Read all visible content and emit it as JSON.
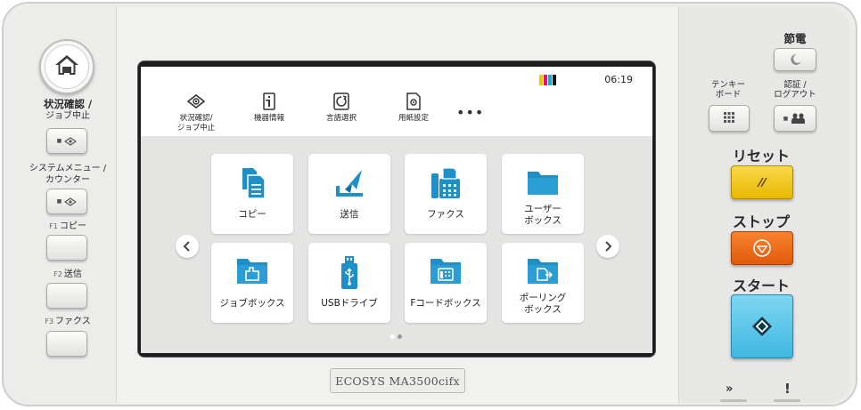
{
  "left_panel": {
    "home": {
      "icon": "home-icon"
    },
    "status_label": [
      "状況確認 /",
      "ジョブ中止"
    ],
    "system_menu_label": [
      "システムメニュー /",
      "カウンター"
    ],
    "f1": {
      "key": "F1",
      "label": "コピー"
    },
    "f2": {
      "key": "F2",
      "label": "送信"
    },
    "f3": {
      "key": "F3",
      "label": "ファクス"
    }
  },
  "screen": {
    "time": "06:19",
    "toner_colors": [
      "#f2c500",
      "#e0127a",
      "#1aa6e0",
      "#111111"
    ],
    "shortcuts": [
      {
        "label": "状況確認/\nジョブ中止",
        "icon": "status-icon"
      },
      {
        "label": "機器情報",
        "icon": "device-info-icon"
      },
      {
        "label": "言語選択",
        "icon": "language-icon"
      },
      {
        "label": "用紙設定",
        "icon": "paper-settings-icon"
      }
    ],
    "more": "•••",
    "tiles": [
      {
        "label": "コピー",
        "icon": "copy-icon"
      },
      {
        "label": "送信",
        "icon": "send-icon"
      },
      {
        "label": "ファクス",
        "icon": "fax-icon"
      },
      {
        "label": "ユーザー\nボックス",
        "icon": "user-box-icon"
      },
      {
        "label": "ジョブボックス",
        "icon": "job-box-icon"
      },
      {
        "label": "USBドライブ",
        "icon": "usb-icon"
      },
      {
        "label": "Fコードボックス",
        "icon": "fcode-box-icon"
      },
      {
        "label": "ポーリング\nボックス",
        "icon": "polling-box-icon"
      }
    ],
    "accent": "#1f8fc8"
  },
  "model": "ECOSYS MA3500cifx",
  "right_panel": {
    "energy_saver": "節電",
    "keypad_label": [
      "テンキー",
      "ボード"
    ],
    "auth_label": [
      "認証 /",
      "ログアウト"
    ],
    "reset": "リセット",
    "stop": "ストップ",
    "start": "スタート",
    "reset_color": "#f4c718",
    "stop_color": "#f26a1b",
    "start_color": "#5fc8ea"
  }
}
